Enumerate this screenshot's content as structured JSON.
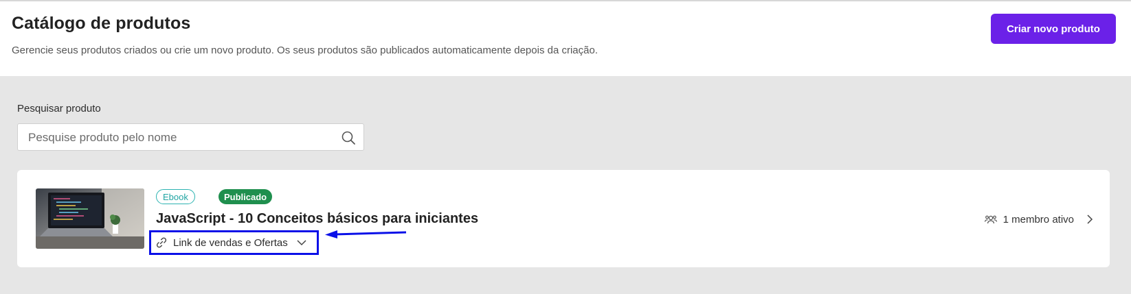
{
  "header": {
    "title": "Catálogo de produtos",
    "subtitle": "Gerencie seus produtos criados ou crie um novo produto. Os seus produtos são publicados automaticamente depois da criação.",
    "create_button": "Criar novo produto"
  },
  "search": {
    "label": "Pesquisar produto",
    "placeholder": "Pesquise produto pelo nome",
    "value": ""
  },
  "products": [
    {
      "type_badge": "Ebook",
      "status_badge": "Publicado",
      "title": "JavaScript - 10 Conceitos básicos para iniciantes",
      "links_label": "Link de vendas e Ofertas",
      "members": "1 membro ativo"
    }
  ],
  "colors": {
    "accent": "#6b21e8",
    "published": "#1f8f4e",
    "ebook": "#2bb3b1",
    "annotation": "#0a10e8"
  },
  "icons": [
    "search-icon",
    "link-icon",
    "chevron-down-icon",
    "members-icon",
    "chevron-right-icon"
  ]
}
